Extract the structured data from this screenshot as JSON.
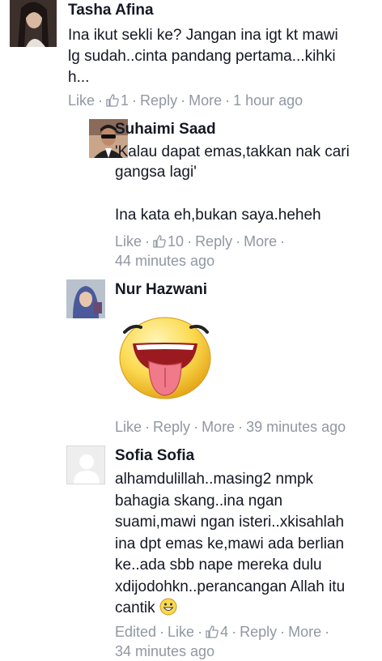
{
  "comments": [
    {
      "name": "Tasha Afina",
      "lines": [
        "Ina ikut sekli ke? Jangan ina igt kt mawi",
        "lg sudah..cinta pandang pertama...kihki",
        "h..."
      ],
      "meta": {
        "like": "Like",
        "likes": "1",
        "reply": "Reply",
        "more": "More",
        "time": "1 hour ago"
      }
    },
    {
      "name": "Suhaimi Saad",
      "lines": [
        "'Kalau dapat emas,takkan nak cari",
        "gangsa lagi'",
        "",
        "Ina kata eh,bukan saya.heheh"
      ],
      "meta": {
        "like": "Like",
        "likes": "10",
        "reply": "Reply",
        "more": "More",
        "time": "44 minutes ago"
      }
    },
    {
      "name": "Nur Hazwani",
      "sticker": "tongue-out-smiley-sticker",
      "meta": {
        "like": "Like",
        "reply": "Reply",
        "more": "More",
        "time": "39 minutes ago"
      }
    },
    {
      "name": "Sofia Sofia",
      "lines": [
        "alhamdulillah..masing2 nmpk",
        "bahagia skang..ina ngan",
        "suami,mawi ngan isteri..xkisahlah",
        "ina dpt emas ke,mawi ada berlian",
        "ke..ada sbb nape mereka dulu",
        "xdijodohkn..perancangan Allah itu"
      ],
      "last_line": "cantik",
      "meta": {
        "edited": "Edited",
        "like": "Like",
        "likes": "4",
        "reply": "Reply",
        "more": "More",
        "time": "34 minutes ago"
      }
    }
  ],
  "colors": {
    "meta": "#9197a3",
    "text": "#141823"
  }
}
